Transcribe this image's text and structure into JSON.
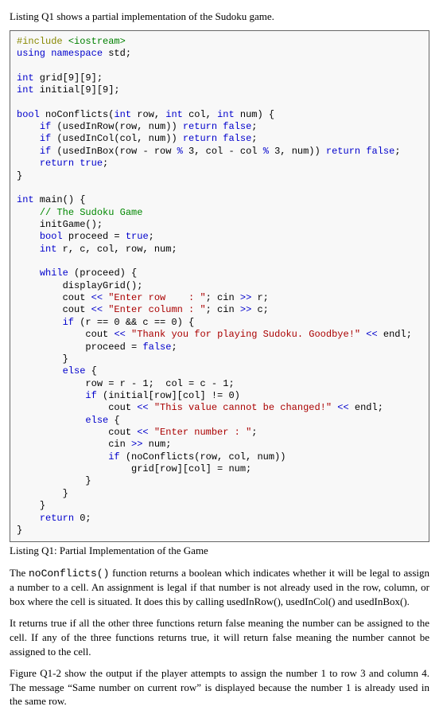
{
  "intro": "Listing Q1 shows a partial implementation of the Sudoku game.",
  "caption": "Listing Q1: Partial Implementation of the Game",
  "p1a": "The ",
  "p1fn": "noConflicts()",
  "p1b": " function returns a boolean which indicates whether it will be legal to assign a number to a cell. An assignment is legal if that number is not already used in the row, column, or box where the cell is situated. It does this by calling usedInRow(), usedInCol() and usedInBox().",
  "p2": "It returns true if all the other three functions return false meaning the number can be assigned to the cell. If any of the three functions returns true, it will return false meaning the number cannot be assigned to the cell.",
  "p3": "Figure Q1-2 show the output if the player attempts to assign the number 1 to row 3 and column 4. The message “Same number on current row” is displayed because the number 1 is already used in the same row.",
  "code": {
    "pp": "#include",
    "inc": "<iostream>",
    "kw_using": "using",
    "kw_namespace": "namespace",
    "std": "std;",
    "kw_int": "int",
    "kw_bool": "bool",
    "kw_if": "if",
    "kw_else": "else",
    "kw_while": "while",
    "kw_return": "return",
    "kw_true": "true",
    "kw_false": "false",
    "grid_decl": " grid[9][9];",
    "initial_decl": " initial[9][9];",
    "noConflicts_sig_a": " noConflicts(",
    "row_param": " row, ",
    "col_param": " col, ",
    "num_param": " num) {",
    "usedInRow": " (usedInRow(row, num)) ",
    "usedInCol": " (usedInCol(col, num)) ",
    "usedInBox_a": " (usedInBox(row - row ",
    "mod": "%",
    "usedInBox_b": " 3, col - col ",
    "usedInBox_c": " 3, num)) ",
    "semicolon": ";",
    "main_sig": " main() {",
    "comment": "// The Sudoku Game",
    "initGame": "initGame();",
    "proceed_decl": " proceed = ",
    "vars_decl": " r, c, col, row, num;",
    "while_cond": " (proceed) {",
    "displayGrid": "displayGrid();",
    "cout": "cout ",
    "lt2": "<<",
    "gt2": ">>",
    "str_row": "\"Enter row    : \"",
    "str_col": "\"Enter column : \"",
    "cin_r": "; cin ",
    "r_semi": " r;",
    "c_semi": " c;",
    "if_zero": " (r == 0 && c == 0) {",
    "str_bye": "\"Thank you for playing Sudoku. Goodbye!\"",
    "endl": " endl;",
    "proceed_false": "proceed = ",
    "else_brace": " {",
    "row_assign": "row = r - 1;  col = c - 1;",
    "if_initial": " (initial[row][col] != 0)",
    "str_nochange": "\"This value cannot be changed!\"",
    "str_num": "\"Enter number : \"",
    "cin_num": "cin ",
    "num_semi": " num;",
    "if_noconf": " (noConflicts(row, col, num))",
    "grid_assign": "grid[row][col] = num;",
    "return0": " 0;",
    "close": "}"
  }
}
